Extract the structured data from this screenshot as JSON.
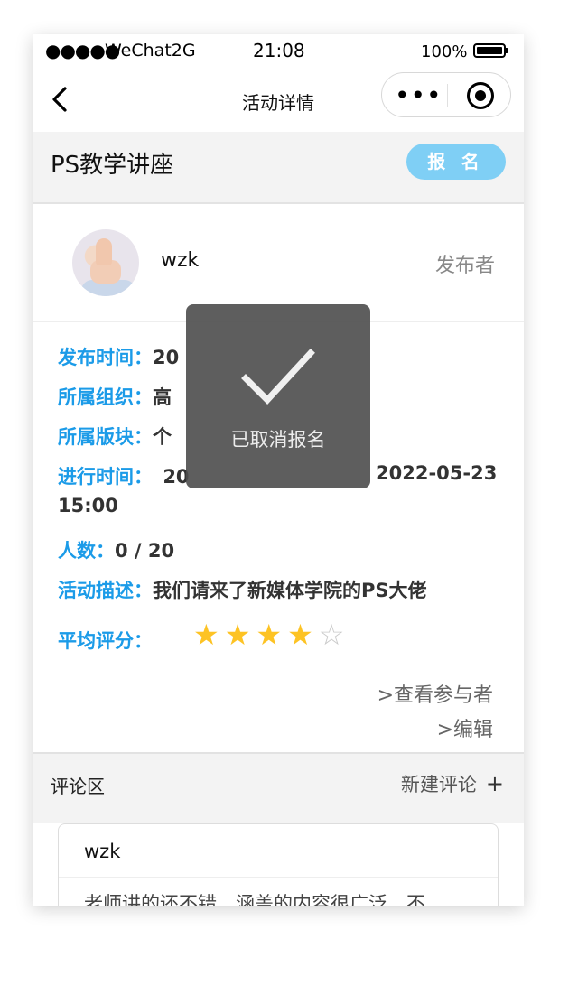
{
  "status_bar": {
    "signal": "●●●●●",
    "carrier": "WeChat2G",
    "time": "21:08",
    "battery": "100%"
  },
  "nav": {
    "title": "活动详情",
    "menu_icon": "more-dots-icon",
    "close_icon": "target-icon"
  },
  "event": {
    "title": "PS教学讲座",
    "signup_label": "报 名"
  },
  "publisher": {
    "name": "wzk",
    "role": "发布者"
  },
  "details": {
    "publish_time_label": "发布时间：",
    "publish_time_value": "20",
    "org_label": "所属组织：",
    "org_value": "高",
    "section_label": "所属版块：",
    "section_value": "个",
    "time_label": "进行时间：",
    "time_start": "20",
    "time_end": "2022-05-23",
    "time_end_clock": "15:00",
    "people_label": "人数：",
    "people_value": "0 / 20",
    "desc_label": "活动描述：",
    "desc_value": "我们请来了新媒体学院的PS大佬",
    "rating_label": "平均评分：",
    "rating_value": 4,
    "rating_max": 5,
    "view_participants": ">查看参与者",
    "edit": ">编辑"
  },
  "comments": {
    "section_title": "评论区",
    "new_comment": "新建评论",
    "new_comment_icon": "plus-icon",
    "items": [
      {
        "user": "wzk",
        "text": "老师讲的还不错，涵盖的内容很广泛，不"
      }
    ]
  },
  "toast": {
    "icon": "checkmark-icon",
    "message": "已取消报名"
  },
  "colors": {
    "accent_label": "#1b9be8",
    "signup_button": "#7fcff5",
    "star": "#fdc324"
  }
}
